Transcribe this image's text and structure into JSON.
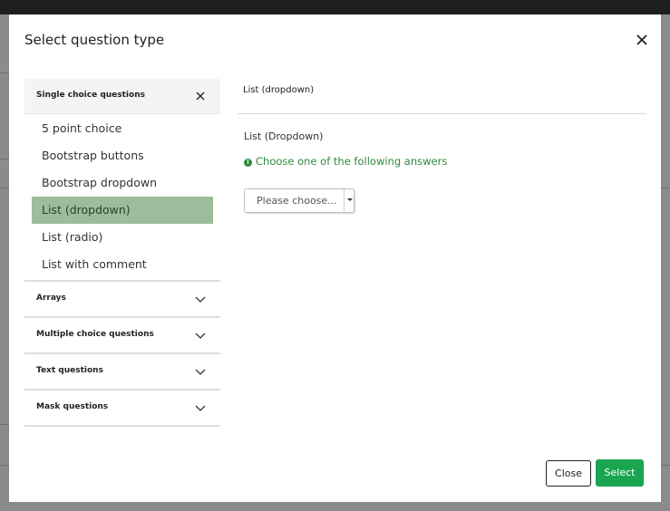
{
  "modal": {
    "title": "Select question type",
    "close_icon": "close-icon"
  },
  "groups": [
    {
      "label": "Single choice questions",
      "open": true,
      "items": [
        {
          "label": "5 point choice",
          "active": false
        },
        {
          "label": "Bootstrap buttons",
          "active": false
        },
        {
          "label": "Bootstrap dropdown",
          "active": false
        },
        {
          "label": "List (dropdown)",
          "active": true
        },
        {
          "label": "List (radio)",
          "active": false
        },
        {
          "label": "List with comment",
          "active": false
        }
      ]
    },
    {
      "label": "Arrays",
      "open": false
    },
    {
      "label": "Multiple choice questions",
      "open": false
    },
    {
      "label": "Text questions",
      "open": false
    },
    {
      "label": "Mask questions",
      "open": false
    }
  ],
  "preview": {
    "title": "List (dropdown)",
    "question_text": "List (Dropdown)",
    "help_text": "Choose one of the following answers",
    "select_placeholder": "Please choose..."
  },
  "footer": {
    "close_label": "Close",
    "select_label": "Select"
  },
  "colors": {
    "active_item": "#9bbd9b",
    "select_button": "#1aa550",
    "help_text": "#2e8b3a"
  }
}
